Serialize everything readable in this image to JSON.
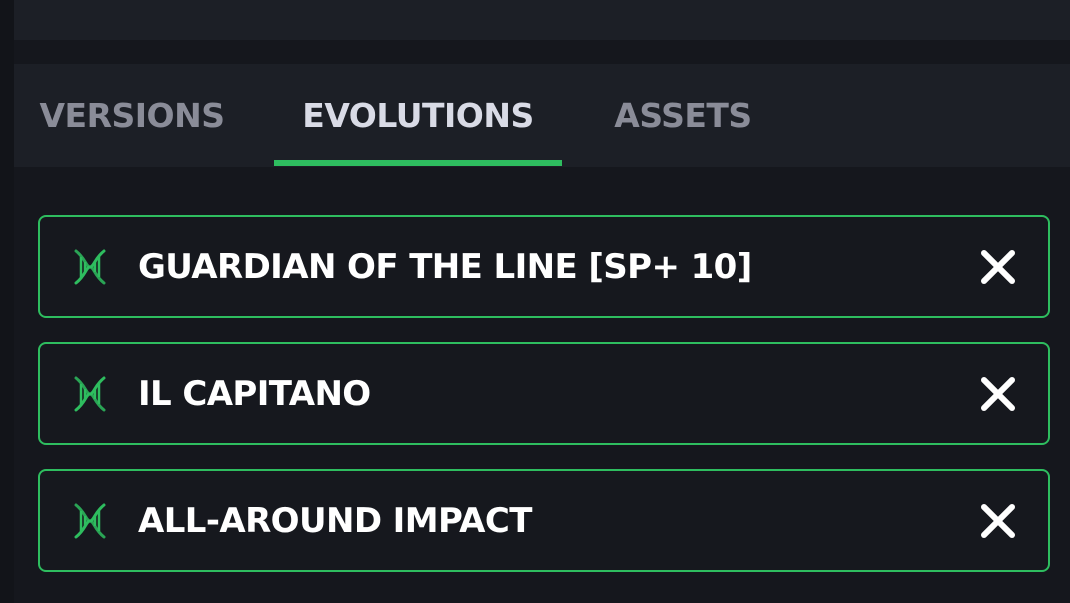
{
  "tabs": [
    {
      "label": "VERSIONS",
      "active": false
    },
    {
      "label": "EVOLUTIONS",
      "active": true
    },
    {
      "label": "ASSETS",
      "active": false
    }
  ],
  "evolutions": [
    {
      "label": "GUARDIAN OF THE LINE [SP+ 10]",
      "icon": "dna-icon",
      "action_icon": "close-icon"
    },
    {
      "label": "IL CAPITANO",
      "icon": "dna-icon",
      "action_icon": "close-icon"
    },
    {
      "label": "ALL-AROUND IMPACT",
      "icon": "dna-icon",
      "action_icon": "close-icon"
    }
  ],
  "colors": {
    "accent": "#2ebd5f",
    "background": "#15171d",
    "panel": "#1c1f26",
    "tab_inactive": "#8a8c98",
    "tab_active": "#d9dbe6",
    "text": "#ffffff"
  }
}
